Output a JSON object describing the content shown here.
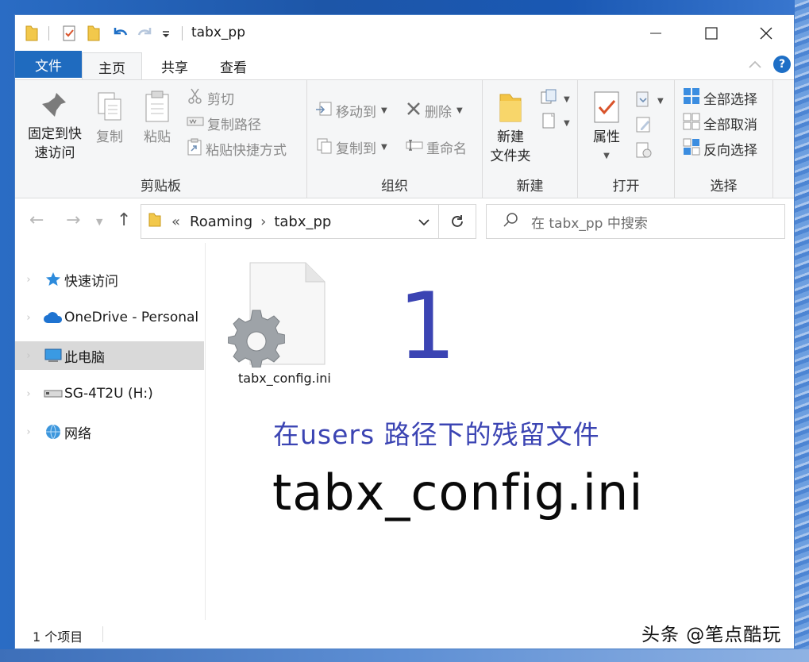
{
  "window": {
    "title": "tabx_pp"
  },
  "ribbon_tabs": [
    {
      "label": "文件"
    },
    {
      "label": "主页"
    },
    {
      "label": "共享"
    },
    {
      "label": "查看"
    }
  ],
  "help_label": "?",
  "clipboard": {
    "pin_label_1": "固定到快",
    "pin_label_2": "速访问",
    "copy_label": "复制",
    "paste_label": "粘贴",
    "cut_label": "剪切",
    "copy_path_label": "复制路径",
    "paste_shortcut_label": "粘贴快捷方式",
    "group_label": "剪贴板"
  },
  "organize": {
    "move_to_label": "移动到",
    "copy_to_label": "复制到",
    "delete_label": "删除",
    "rename_label": "重命名",
    "group_label": "组织"
  },
  "new": {
    "new_folder_label_1": "新建",
    "new_folder_label_2": "文件夹",
    "group_label": "新建"
  },
  "open": {
    "properties_label": "属性",
    "group_label": "打开"
  },
  "select": {
    "select_all_label": "全部选择",
    "select_none_label": "全部取消",
    "invert_label": "反向选择",
    "group_label": "选择"
  },
  "address": {
    "overflow": "«",
    "crumbs": [
      "Roaming",
      "tabx_pp"
    ],
    "separator": "›"
  },
  "search": {
    "placeholder": "在 tabx_pp 中搜索"
  },
  "sidebar": {
    "items": [
      {
        "label": "快速访问"
      },
      {
        "label": "OneDrive - Personal"
      },
      {
        "label": "此电脑"
      },
      {
        "label": "SG-4T2U (H:)"
      },
      {
        "label": "网络"
      }
    ]
  },
  "files": [
    {
      "name": "tabx_config.ini"
    }
  ],
  "overlay": {
    "number": "1",
    "caption": "在users 路径下的残留文件",
    "filename": "tabx_config.ini"
  },
  "status": {
    "item_count": "1 个项目"
  },
  "watermark": "头条 @笔点酷玩",
  "colors": {
    "accent": "#1f6bbf",
    "overlay_text": "#3b44b3",
    "selected_bg": "#d9d9d9"
  }
}
